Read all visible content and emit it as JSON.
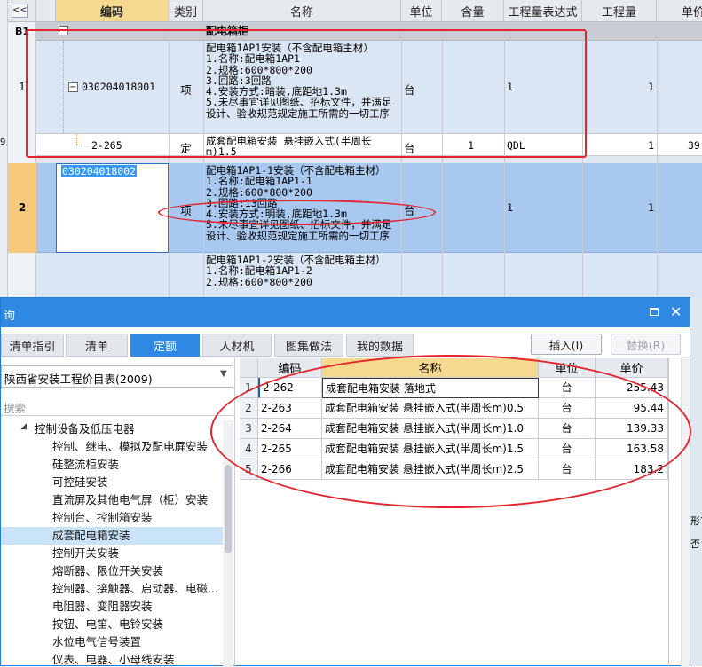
{
  "grid": {
    "collapse_btn": "<<",
    "headers": [
      "编码",
      "类别",
      "名称",
      "单位",
      "含量",
      "工程量表达式",
      "工程量",
      "单价"
    ],
    "group_row": {
      "id": "B1",
      "toggle": "−",
      "name": "配电箱柜"
    },
    "row1": {
      "num": "1",
      "toggle": "−",
      "code": "030204018001",
      "type": "项",
      "desc": "配电箱1AP1安装（不含配电箱主材）\n1.名称:配电箱1AP1\n2.规格:600*800*200\n3.回路:3回路\n4.安装方式:暗装,底距地1.3m\n5.未尽事宜详见图纸、招标文件，并满足\n设计、验收规范规定施工所需的一切工序",
      "unit": "台",
      "expr": "1",
      "qty": "1"
    },
    "sub1": {
      "code": "2-265",
      "type": "定",
      "desc": "成套配电箱安装 悬挂嵌入式(半周长\nm)1.5",
      "unit": "台",
      "content": "1",
      "expr": "QDL",
      "qty": "1",
      "price": "39"
    },
    "row2": {
      "num": "2",
      "code": "030204018002",
      "type": "项",
      "desc": "配电箱1AP1-1安装（不含配电箱主材）\n1.名称:配电箱1AP1-1\n2.规格:600*800*200\n3.回路:13回路\n4.安装方式:明装,底距地1.3m\n5.未尽事宜详见图纸、招标文件，并满足\n设计、验收规范规定施工所需的一切工序",
      "unit": "台",
      "expr": "1",
      "qty": "1"
    },
    "row3": {
      "desc": "配电箱1AP1-2安装（不含配电箱主材）\n1.名称:配电箱1AP1-2\n2.规格:600*800*200"
    },
    "left_gutter_mark": "9"
  },
  "dialog": {
    "title": "询",
    "tabs": [
      "清单指引",
      "清单",
      "定额",
      "人材机",
      "图集做法",
      "我的数据"
    ],
    "active_tab": "定额",
    "insert_button": "插入(I)",
    "replace_button": "替换(R)",
    "library_select": "陕西省安装工程价目表(2009)",
    "search_placeholder": "搜索",
    "tree_root": "控制设备及低压电器",
    "tree_items": [
      "控制、继电、模拟及配电屏安装",
      "硅整流柜安装",
      "可控硅安装",
      "直流屏及其他电气屏（柜）安装",
      "控制台、控制箱安装",
      "成套配电箱安装",
      "控制开关安装",
      "熔断器、限位开关安装",
      "控制器、接触器、启动器、电磁...",
      "电阻器、变阻器安装",
      "按钮、电笛、电铃安装",
      "水位电气信号装置",
      "仪表、电器、小母线安装"
    ],
    "selected_tree_item": "成套配电箱安装",
    "table_headers": [
      "编码",
      "名称",
      "单位",
      "单价"
    ],
    "rows": [
      {
        "num": "1",
        "code": "2-262",
        "name": "成套配电箱安装 落地式",
        "unit": "台",
        "price": "255.43"
      },
      {
        "num": "2",
        "code": "2-263",
        "name": "成套配电箱安装 悬挂嵌入式(半周长m)0.5",
        "unit": "台",
        "price": "95.44"
      },
      {
        "num": "3",
        "code": "2-264",
        "name": "成套配电箱安装 悬挂嵌入式(半周长m)1.0",
        "unit": "台",
        "price": "139.33"
      },
      {
        "num": "4",
        "code": "2-265",
        "name": "成套配电箱安装 悬挂嵌入式(半周长m)1.5",
        "unit": "台",
        "price": "163.58"
      },
      {
        "num": "5",
        "code": "2-266",
        "name": "成套配电箱安装 悬挂嵌入式(半周长m)2.5",
        "unit": "台",
        "price": "183.2"
      }
    ],
    "right_edge_text_1": "形?",
    "right_edge_text_2": "否套"
  },
  "colors": {
    "annotation_red": "#e5232d",
    "accent_blue": "#2f89e3",
    "row_light": "#dbe6f4",
    "row_selected": "#a9c8f0"
  }
}
